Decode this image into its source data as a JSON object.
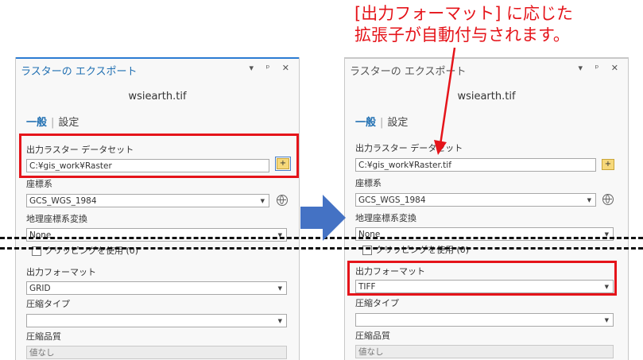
{
  "callout": {
    "line1": "[出力フォーマット] に応じた",
    "line2": "拡張子が自動付与されます。"
  },
  "left_panel": {
    "title": "ラスターの エクスポート",
    "controls": "▾ ᵖ ✕",
    "file_name": "wsiearth.tif",
    "tab_general": "一般",
    "tab_settings": "設定",
    "output_raster_label": "出力ラスター データセット",
    "output_raster_value": "C:¥gis_work¥Raster",
    "coord_label": "座標系",
    "coord_value": "GCS_WGS_1984",
    "geo_transform_label": "地理座標系変換",
    "geo_transform_value": "None",
    "clip_checkbox_label": "クリッピングを使用 (0)",
    "output_format_label": "出力フォーマット",
    "output_format_value": "GRID",
    "compression_type_label": "圧縮タイプ",
    "compression_type_value": "",
    "compression_quality_label": "圧縮品質",
    "compression_quality_value": "値なし"
  },
  "right_panel": {
    "title": "ラスターの エクスポート",
    "controls": "▾ ᵖ ✕",
    "file_name": "wsiearth.tif",
    "tab_general": "一般",
    "tab_settings": "設定",
    "output_raster_label": "出力ラスター データセット",
    "output_raster_value": "C:¥gis_work¥Raster.tif",
    "coord_label": "座標系",
    "coord_value": "GCS_WGS_1984",
    "geo_transform_label": "地理座標系変換",
    "geo_transform_value": "None",
    "clip_checkbox_label": "クリッピングを使用 (0)",
    "output_format_label": "出力フォーマット",
    "output_format_value": "TIFF",
    "compression_type_label": "圧縮タイプ",
    "compression_type_value": "",
    "compression_quality_label": "圧縮品質",
    "compression_quality_value": "値なし"
  },
  "colors": {
    "accent": "#1f6fb2",
    "highlight": "#e5141a",
    "arrow": "#4472c4",
    "left_top_border": "#2b7cd3",
    "right_top_border": "#c8c8c8"
  },
  "icons": {
    "browse": "folder-add-icon",
    "coord": "globe-icon",
    "dropdown": "chevron-down-icon",
    "right_arrow": "arrow-right-icon"
  }
}
